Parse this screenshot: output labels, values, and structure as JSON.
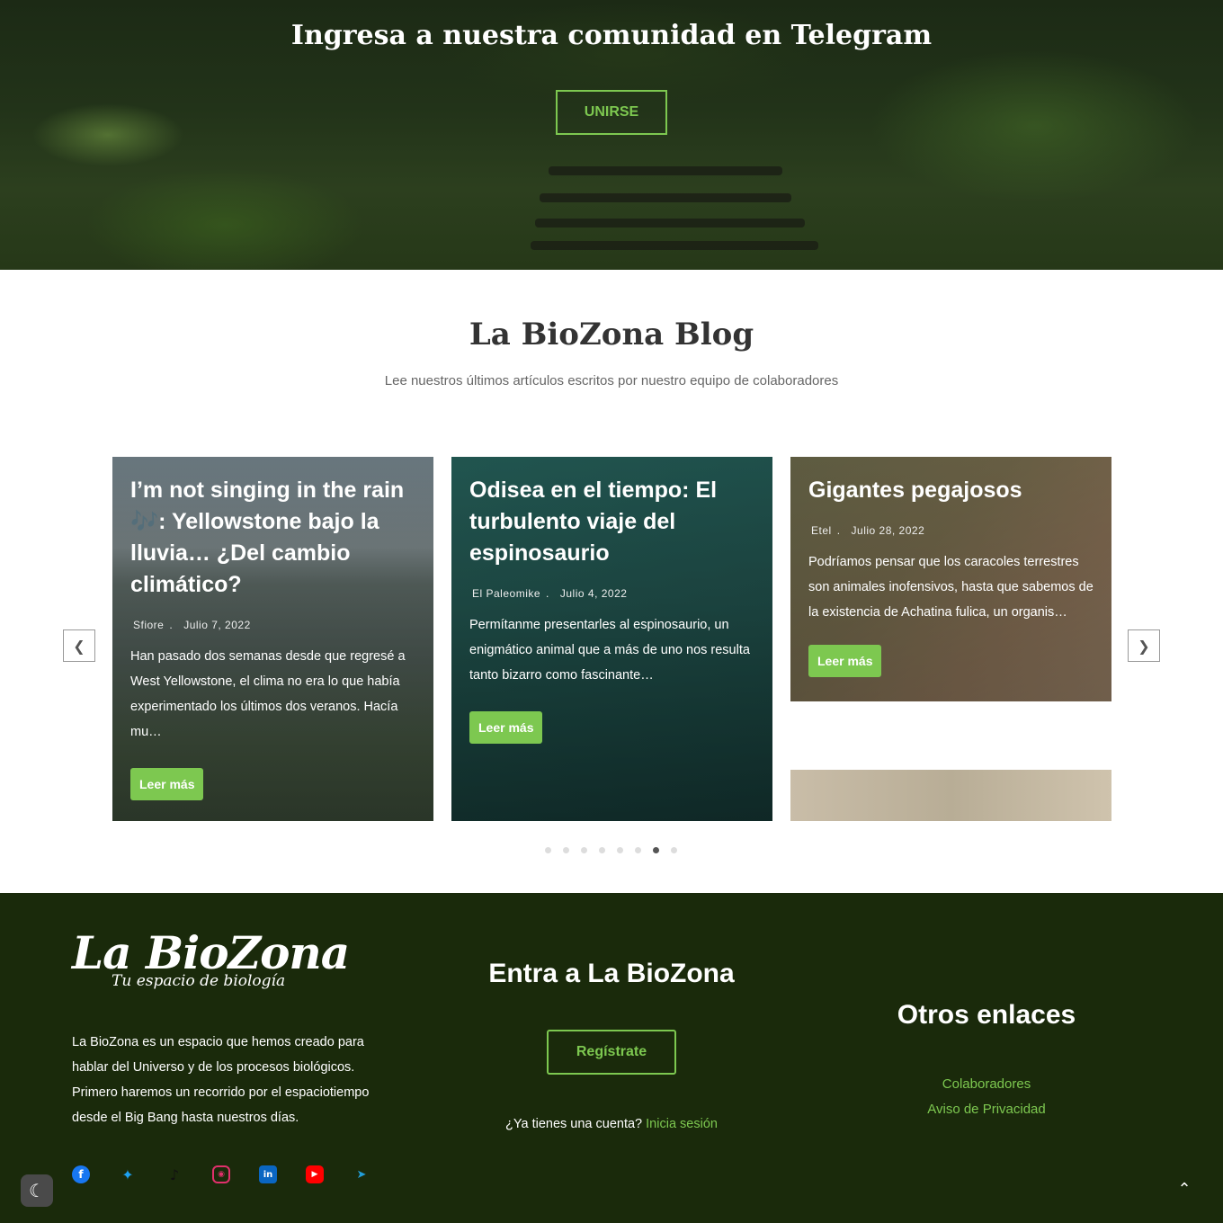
{
  "hero": {
    "title": "Ingresa a nuestra comunidad en Telegram",
    "button": "UNIRSE"
  },
  "blog": {
    "title": "La BioZona Blog",
    "subtitle": "Lee nuestros últimos artículos escritos por nuestro equipo de colaboradores",
    "prev_icon": "chevron-left-icon",
    "next_icon": "chevron-right-icon",
    "posts": [
      {
        "title": "I’m not singing in the rain 🎶: Yellowstone bajo la lluvia… ¿Del cambio climático?",
        "author": "Sfiore",
        "date": "Julio 7, 2022",
        "excerpt": "Han pasado dos semanas desde que regresé a West Yellowstone, el clima no era lo que había experimentado los últimos dos veranos. Hacía mu…",
        "cta": "Leer más"
      },
      {
        "title": "Odisea en el tiempo: El turbulento viaje del espinosaurio",
        "author": "El Paleomike",
        "date": "Julio 4, 2022",
        "excerpt": "Permítanme presentarles al espinosaurio, un enigmático animal que a más de uno nos resulta tanto bizarro como fascinante…",
        "cta": "Leer más"
      },
      {
        "title": "Gigantes pegajosos",
        "author": "Etel",
        "date": "Julio 28, 2022",
        "excerpt": "Podríamos pensar que los caracoles terrestres son animales inofensivos, hasta que sabemos de la existencia de Achatina fulica, un organis…",
        "cta": "Leer más"
      }
    ],
    "dots_total": 8,
    "dots_active": 7,
    "meta_separator": "."
  },
  "footer": {
    "logo_main": "La BioZona",
    "logo_tagline": "Tu espacio de biología",
    "description": "La BioZona es un espacio que hemos creado para hablar del Universo y de los procesos biológicos. Primero haremos un recorrido por el espaciotiempo desde el Big Bang hasta nuestros días.",
    "cta_title": "Entra a La BioZona",
    "register_button": "Regístrate",
    "login_prompt": "¿Ya tienes una cuenta?",
    "login_link": "Inicia sesión",
    "links_title": "Otros enlaces",
    "links": [
      "Colaboradores",
      "Aviso de Privacidad"
    ],
    "socials": [
      "facebook-icon",
      "twitter-icon",
      "tiktok-icon",
      "instagram-icon",
      "linkedin-icon",
      "youtube-icon",
      "telegram-icon"
    ]
  },
  "colors": {
    "accent": "#7dc850",
    "footer_bg": "#1a2a0b"
  }
}
